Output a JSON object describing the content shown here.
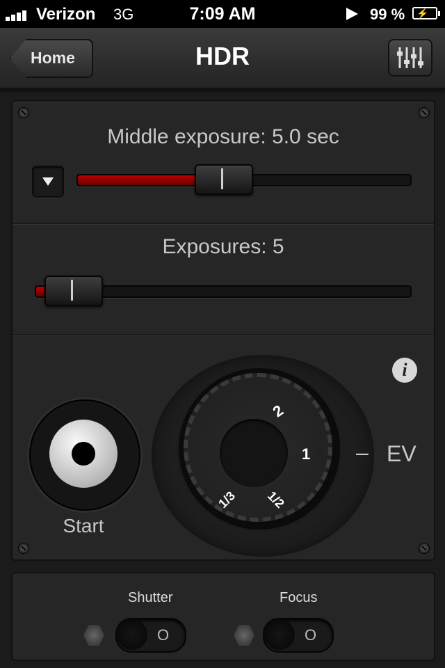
{
  "status_bar": {
    "carrier": "Verizon",
    "network": "3G",
    "time": "7:09 AM",
    "battery_percent": "99 %"
  },
  "nav": {
    "back_label": "Home",
    "title": "HDR"
  },
  "middle_exposure": {
    "label": "Middle exposure: 5.0 sec",
    "slider_fraction": 0.44
  },
  "exposures": {
    "label": "Exposures: 5",
    "slider_fraction": 0.1
  },
  "start": {
    "label": "Start"
  },
  "ev_dial": {
    "marks": [
      "2",
      "1",
      "1/2",
      "1/3"
    ],
    "minus": "–",
    "unit": "EV"
  },
  "toggles": {
    "shutter": {
      "label": "Shutter",
      "state": "O"
    },
    "focus": {
      "label": "Focus",
      "state": "O"
    }
  },
  "colors": {
    "accent_red": "#aa0000",
    "background": "#1b1b1b"
  }
}
